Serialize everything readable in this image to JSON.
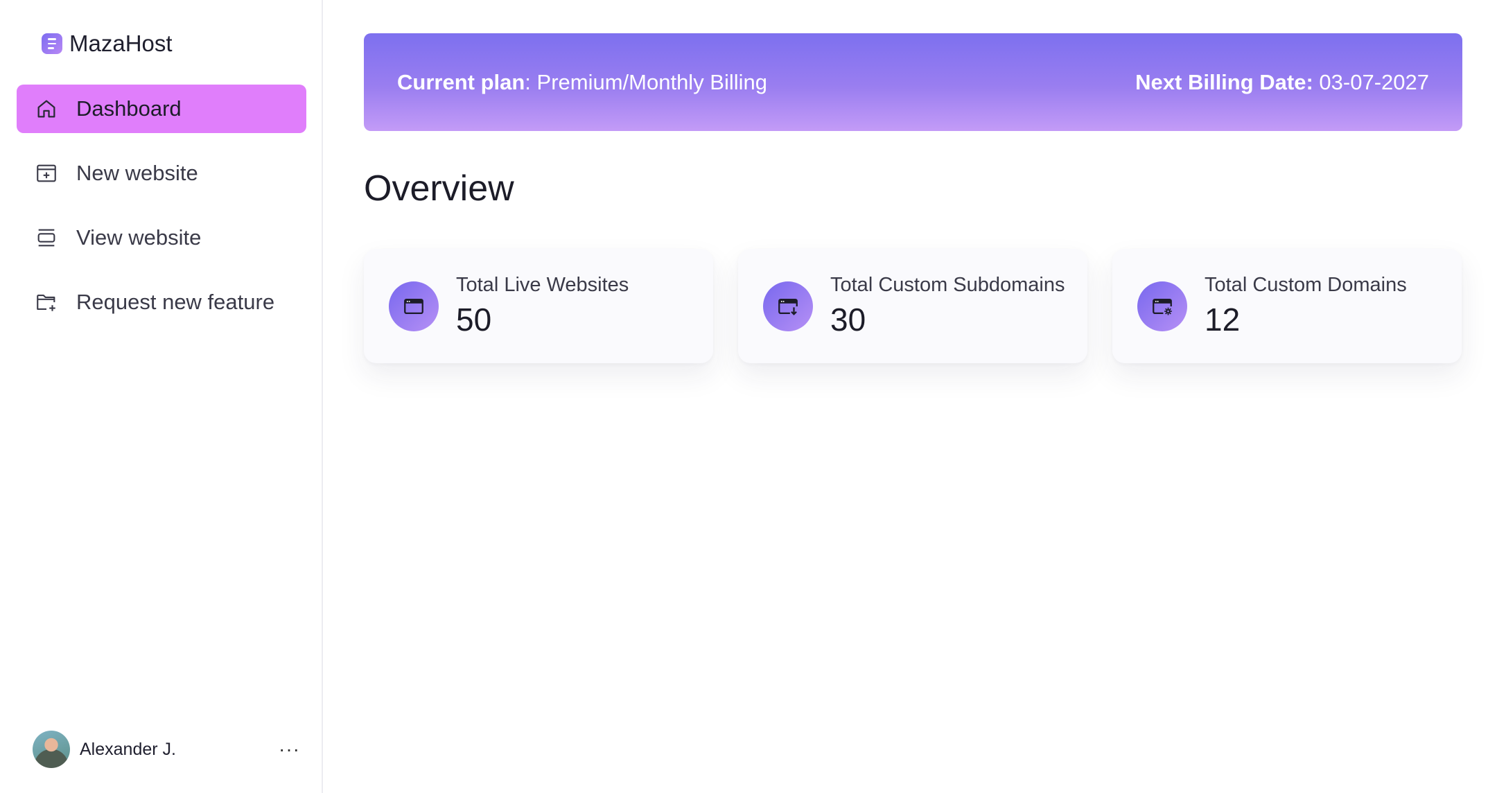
{
  "brand": {
    "name": "MazaHost"
  },
  "sidebar": {
    "items": [
      {
        "label": "Dashboard",
        "icon": "home-icon",
        "active": true
      },
      {
        "label": "New website",
        "icon": "new-window-icon",
        "active": false
      },
      {
        "label": "View website",
        "icon": "stack-icon",
        "active": false
      },
      {
        "label": "Request new feature",
        "icon": "folder-plus-icon",
        "active": false
      }
    ]
  },
  "user": {
    "name": "Alexander J.",
    "menu_label": "···"
  },
  "banner": {
    "plan_label": "Current plan",
    "plan_value": ": Premium/Monthly Billing",
    "billing_label": "Next Billing Date:",
    "billing_value": " 03-07-2027"
  },
  "overview": {
    "title": "Overview",
    "cards": [
      {
        "label": "Total Live Websites",
        "value": "50",
        "icon": "browser-window-icon"
      },
      {
        "label": "Total Custom Subdomains",
        "value": "30",
        "icon": "browser-download-icon"
      },
      {
        "label": "Total Custom Domains",
        "value": "12",
        "icon": "browser-settings-icon"
      }
    ]
  },
  "colors": {
    "accent": "#e07efb",
    "banner_start": "#7d70ef",
    "banner_end": "#c39bf7",
    "icon_bg": "#8b78f0"
  }
}
